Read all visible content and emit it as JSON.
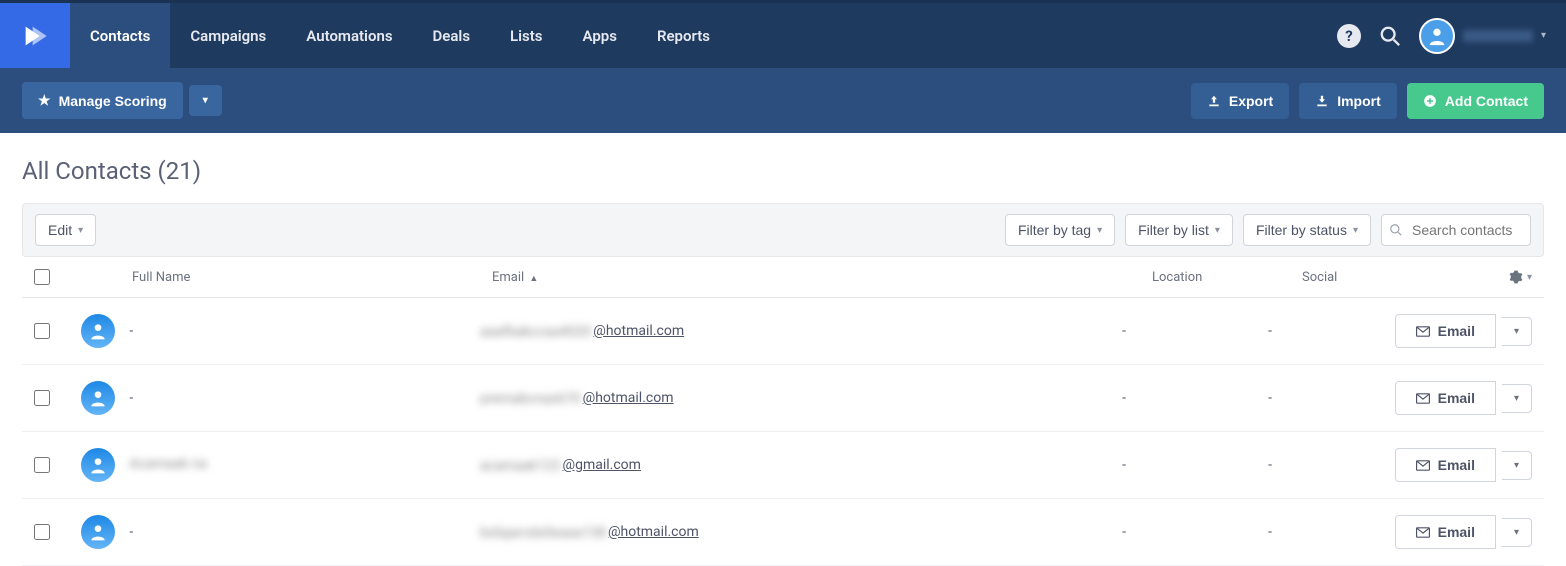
{
  "nav": {
    "items": [
      "Contacts",
      "Campaigns",
      "Automations",
      "Deals",
      "Lists",
      "Apps",
      "Reports"
    ],
    "active_index": 0
  },
  "user": {
    "name": "████████"
  },
  "subbar": {
    "manage_scoring": "Manage Scoring",
    "export": "Export",
    "import": "Import",
    "add_contact": "Add Contact"
  },
  "page_title": "All Contacts (21)",
  "toolbar": {
    "edit": "Edit",
    "filter_tag": "Filter by tag",
    "filter_list": "Filter by list",
    "filter_status": "Filter by status",
    "search_placeholder": "Search contacts"
  },
  "columns": {
    "full_name": "Full Name",
    "email": "Email",
    "location": "Location",
    "social": "Social"
  },
  "rows": [
    {
      "name": "-",
      "email_prefix_blur": "aaafbakccaa4020",
      "email_domain": "@hotmail.com",
      "location": "-",
      "social": "-"
    },
    {
      "name": "-",
      "email_prefix_blur": "premabcnax670",
      "email_domain": "@hotmail.com",
      "location": "-",
      "social": "-"
    },
    {
      "name": "████████",
      "email_prefix_blur": "acamaak122",
      "email_domain": "@gmail.com",
      "location": "-",
      "social": "-"
    },
    {
      "name": "-",
      "email_prefix_blur": "bxligarcda5eaaa138",
      "email_domain": "@hotmail.com",
      "location": "-",
      "social": "-"
    }
  ],
  "row_action_label": "Email"
}
